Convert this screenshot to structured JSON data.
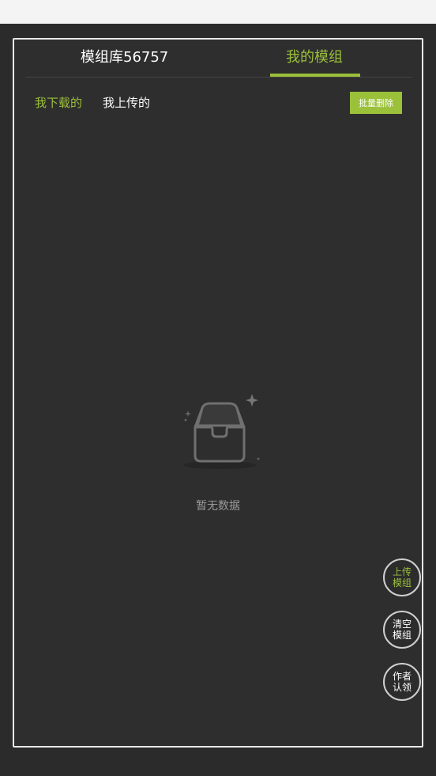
{
  "colors": {
    "accent": "#9bc03a",
    "text_primary": "#ffffff",
    "text_muted": "#9a9a9a",
    "background": "#2e2e2e"
  },
  "tabs": [
    {
      "label": "模组库56757",
      "active": false
    },
    {
      "label": "我的模组",
      "active": true
    }
  ],
  "subtabs": [
    {
      "label": "我下载的",
      "active": true
    },
    {
      "label": "我上传的",
      "active": false
    }
  ],
  "batch_delete_label": "批量删除",
  "empty_state": {
    "icon": "empty-inbox-icon",
    "text": "暂无数据"
  },
  "fabs": {
    "upload": {
      "line1": "上传",
      "line2": "模组"
    },
    "clear": {
      "line1": "清空",
      "line2": "模组"
    },
    "author": {
      "line1": "作者",
      "line2": "认领"
    }
  }
}
